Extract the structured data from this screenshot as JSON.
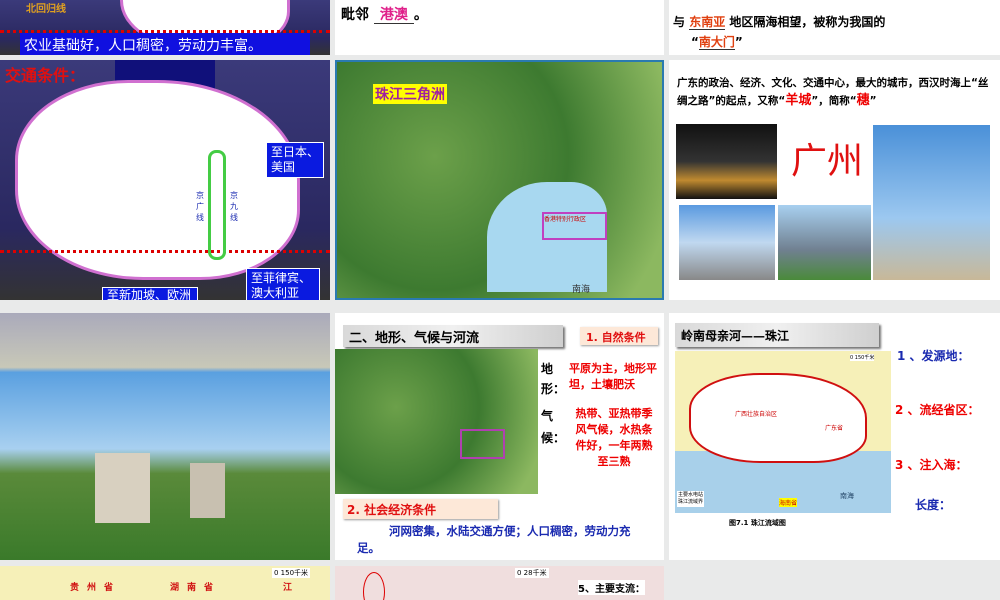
{
  "slides": {
    "s1": {
      "tropic_label": "北回归线",
      "caption": "农业基础好，人口稠密，劳动力丰富。"
    },
    "s2": {
      "prefix": "毗邻",
      "answer": "港澳",
      "suffix": "。"
    },
    "s3": {
      "prefix": "与",
      "answer1": "东南亚",
      "middle": "地区隔海相望，被称为我国的",
      "open_quote": "“",
      "answer2": "南大门",
      "close_quote": "”"
    },
    "s4": {
      "title": "交通条件：",
      "rail1": "京广线",
      "rail2": "京九线",
      "route1": "至日本、美国",
      "route2": "至菲律宾、澳大利亚",
      "route3": "至新加坡、欧洲"
    },
    "s5": {
      "label": "珠江三角洲",
      "sub": "香港特别行政区",
      "sea": "南海"
    },
    "s6": {
      "text1": "广东的政治、经济、文化、交通中心，最大的城市，西汉时海上“丝绸之路”的起点，又称“",
      "nick": "羊城",
      "text2": "”，简称“",
      "abbr": "穗",
      "text3": "”",
      "city": "广州"
    },
    "s8": {
      "title": "二、地形、气候与河流",
      "natural": "1. 自然条件",
      "terrain_label": "地形：",
      "terrain": "平原为主，地形平坦，土壤肥沃",
      "climate_label": "气候：",
      "climate": "热带、亚热带季风气候，水热条件好，一年两熟至三熟",
      "social": "2. 社会经济条件",
      "social_text": "河网密集，水陆交通方便；人口稠密，劳动力充足。"
    },
    "s9": {
      "title": "岭南母亲河——珠江",
      "q1": "1 、发源地：",
      "q2": "2 、流经省区：",
      "q3": "3 、注入海：",
      "q4": "长度：",
      "scale": "0    150千米",
      "legend1": "主要水电站",
      "legend2": "珠江流域界",
      "caption": "图7.1 珠江流域图",
      "p1": "广西壮族自治区",
      "p2": "广东省",
      "p3": "海南省",
      "sea": "南海"
    },
    "s10": {
      "scale": "0    150千米",
      "p1": "贵州省",
      "p2": "湖南省",
      "p3": "江"
    },
    "s11": {
      "scale": "0    28千米",
      "q5": "5、主要支流："
    }
  }
}
